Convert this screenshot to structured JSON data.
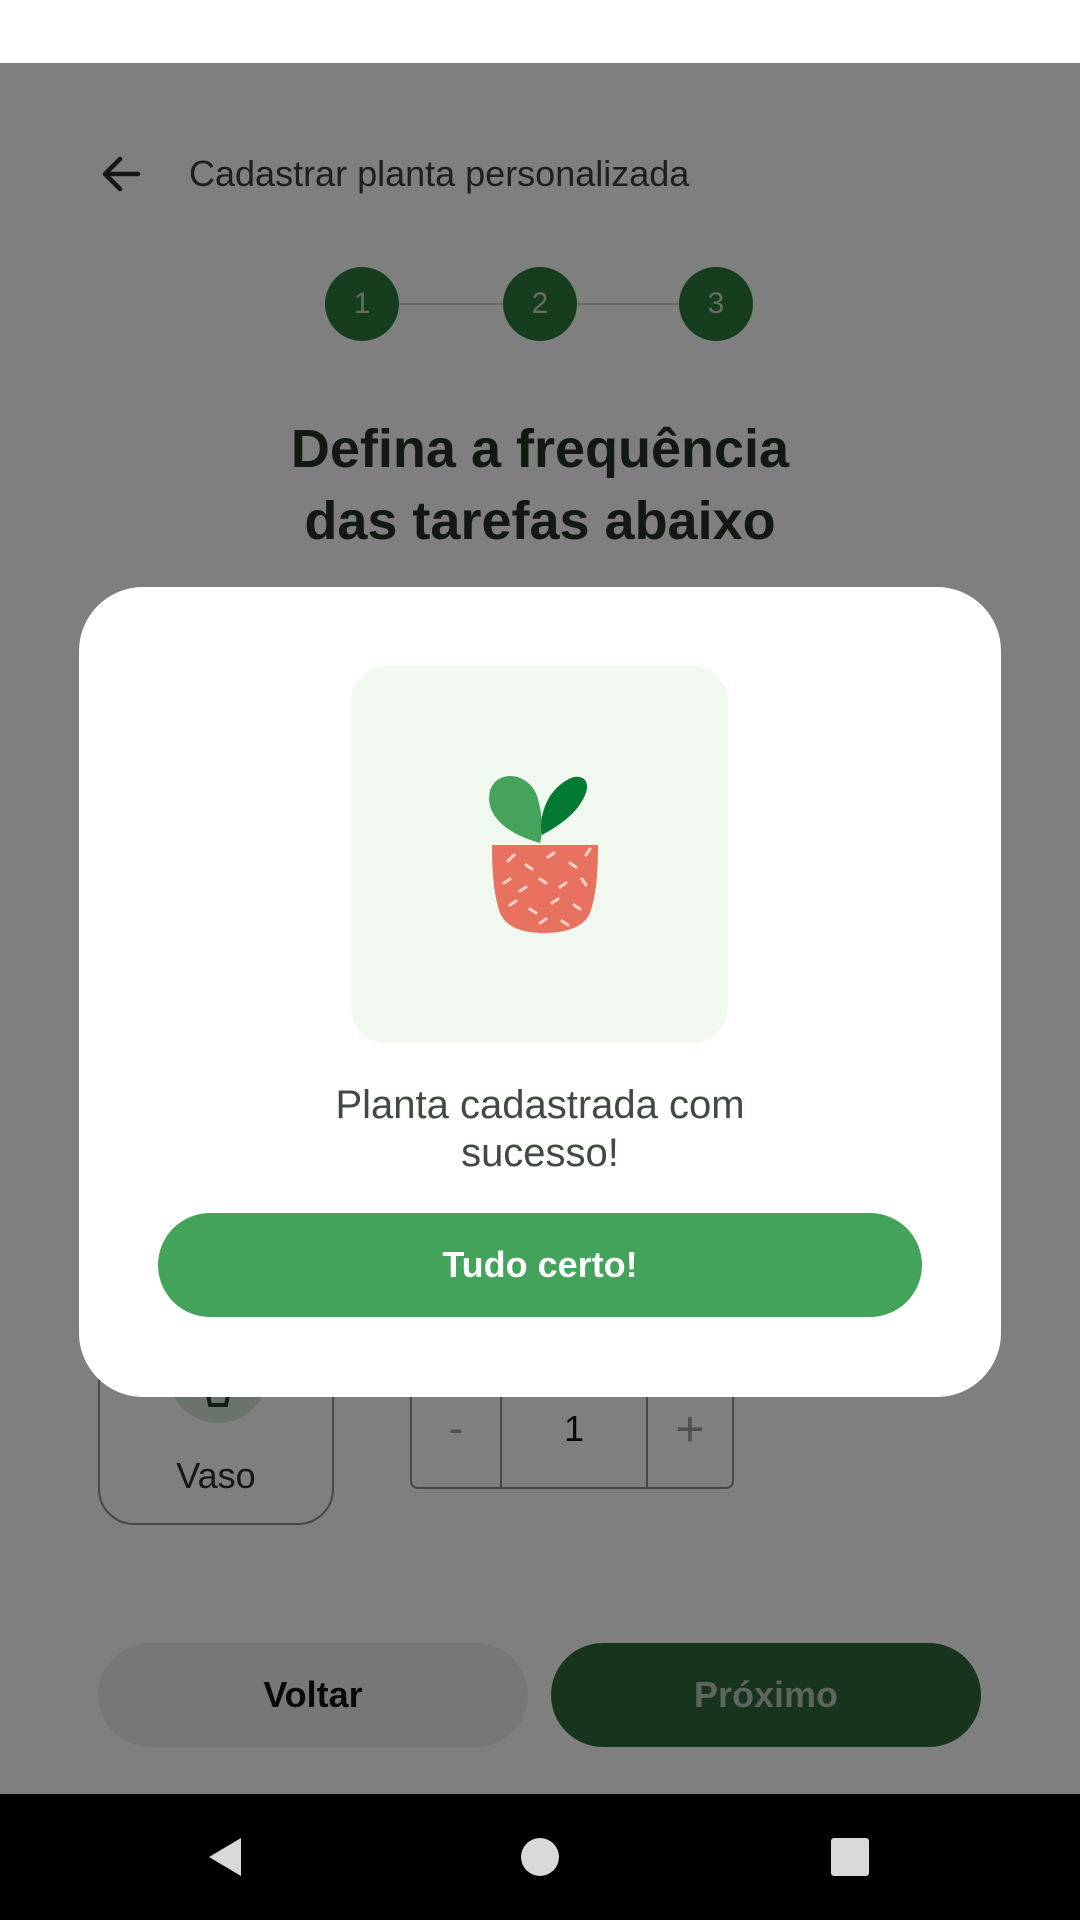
{
  "topbar": {
    "title": "Cadastrar planta personalizada",
    "back_icon": "arrow-left-icon"
  },
  "stepper": {
    "steps": [
      "1",
      "2",
      "3"
    ]
  },
  "page": {
    "heading_line1": "Defina a frequência",
    "heading_line2": "das tarefas abaixo"
  },
  "task": {
    "card_label": "Vaso",
    "icon": "pot-icon",
    "quantity": {
      "minus": "-",
      "value": "1",
      "plus": "+"
    }
  },
  "footer": {
    "back_label": "Voltar",
    "next_label": "Próximo"
  },
  "dialog": {
    "illustration": "plant-in-pot-icon",
    "message_line1": "Planta cadastrada com",
    "message_line2": "sucesso!",
    "confirm_label": "Tudo certo!"
  },
  "navbar": {
    "back_icon": "nav-back-icon",
    "home_icon": "nav-home-icon",
    "recents_icon": "nav-recents-icon"
  },
  "colors": {
    "primary_green": "#43a35a",
    "dark_green": "#2c7a3a",
    "illustration_bg": "#f0f8f0",
    "pot": "#e8715f"
  }
}
